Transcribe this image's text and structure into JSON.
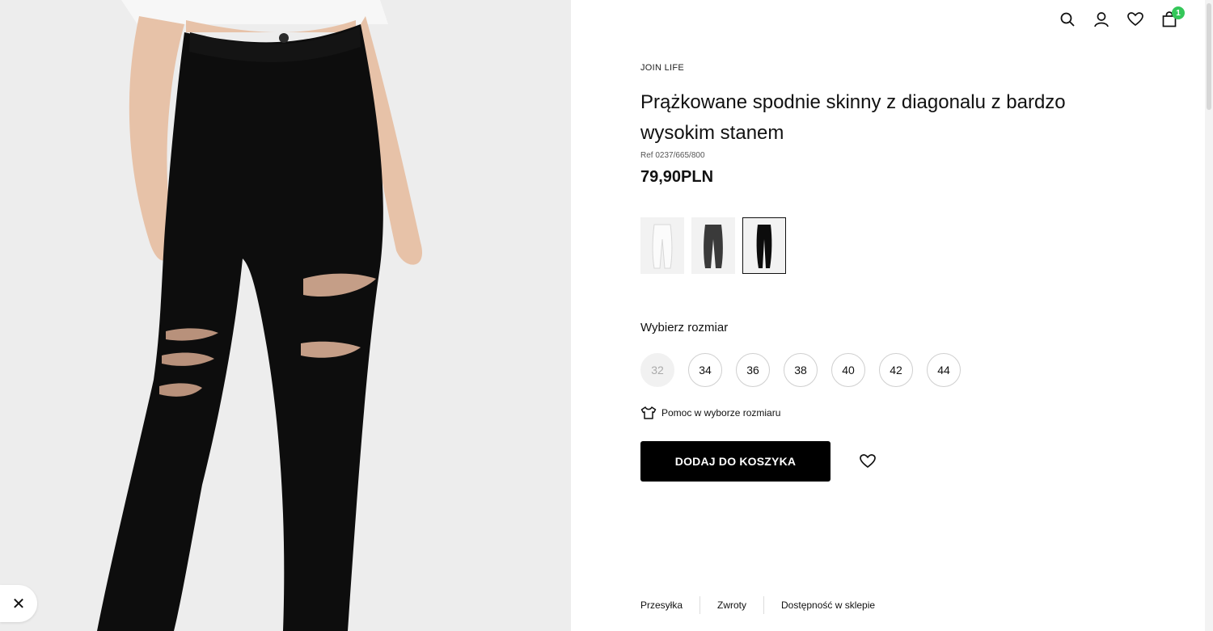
{
  "header": {
    "icons": [
      "search-icon",
      "user-icon",
      "heart-icon",
      "cart-icon"
    ],
    "cart_count": "1"
  },
  "gallery": {
    "close_label": "✕"
  },
  "product": {
    "brand": "JOIN LIFE",
    "title": "Prążkowane spodnie skinny z diagonalu z bardzo wysokim stanem",
    "ref": "Ref 0237/665/800",
    "price": "79,90PLN",
    "colors": [
      "white",
      "dark-grey",
      "black"
    ],
    "selected_color": "black",
    "size_label": "Wybierz rozmiar",
    "sizes": [
      "32",
      "34",
      "36",
      "38",
      "40",
      "42",
      "44"
    ],
    "unavailable_sizes": [
      "32"
    ],
    "size_help": "Pomoc w wyborze rozmiaru",
    "add_to_cart": "DODAJ DO KOSZYKA"
  },
  "info_tabs": [
    "Przesyłka",
    "Zwroty",
    "Dostępność w sklepie"
  ],
  "colors": {
    "accent_badge": "#34c759",
    "button_bg": "#000000",
    "page_bg": "#ffffff"
  }
}
